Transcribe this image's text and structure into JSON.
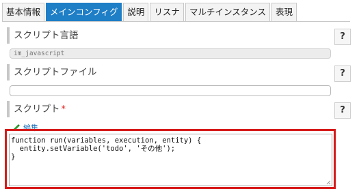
{
  "tabs": [
    {
      "label": "基本情報",
      "active": false
    },
    {
      "label": "メインコンフィグ",
      "active": true
    },
    {
      "label": "説明",
      "active": false
    },
    {
      "label": "リスナ",
      "active": false
    },
    {
      "label": "マルチインスタンス",
      "active": false
    },
    {
      "label": "表現",
      "active": false
    }
  ],
  "script_language": {
    "label": "スクリプト言語",
    "value": "im_javascript",
    "help": "?"
  },
  "script_file": {
    "label": "スクリプトファイル",
    "value": "",
    "help": "?"
  },
  "script": {
    "label": "スクリプト",
    "required_mark": "*",
    "help": "?",
    "edit_link": "編集",
    "code_lines": [
      "function run(variables, execution, entity) {",
      "  entity.setVariable('todo', 'その他');",
      "}"
    ]
  },
  "colors": {
    "active_tab": "#1e7ec6",
    "highlight_border": "#d61a1a",
    "required": "#e02020",
    "edit_icon": "#2e9a2e"
  },
  "icons": {
    "edit": "pencil-icon",
    "resize": "resize-grip-icon"
  }
}
